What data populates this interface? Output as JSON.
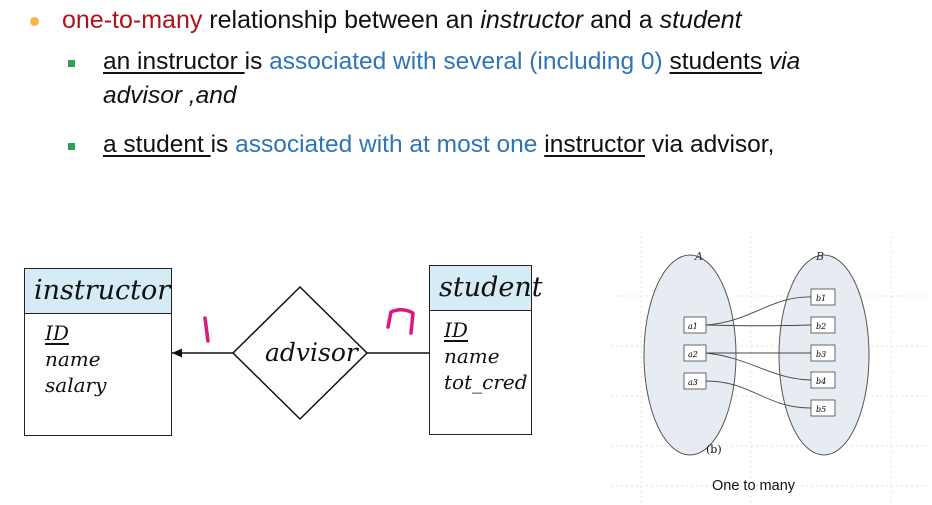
{
  "bullet": {
    "part1": "one-to-many",
    "part2": " relationship between an ",
    "part3": "instructor",
    "part4": " and a ",
    "part5": "student"
  },
  "sub1": {
    "a": "an instructor ",
    "b": "is ",
    "c": "associated with several (including 0)",
    "d": " ",
    "e": "students",
    "f": " via",
    "g": "advisor ,and"
  },
  "sub2": {
    "a": "a student ",
    "b": "is ",
    "c": "associated with at most one",
    "d": " ",
    "e": "instructor",
    "f": " via advisor,"
  },
  "er": {
    "instructor": {
      "name": "instructor",
      "attrs": [
        "ID",
        "name",
        "salary"
      ]
    },
    "student": {
      "name": "student",
      "attrs": [
        "ID",
        "name",
        "tot_cred"
      ]
    },
    "relationship": "advisor",
    "card_left": "1",
    "card_right": "n",
    "annotation_color": "#e0157e"
  },
  "setfig": {
    "set_a": "A",
    "set_b": "B",
    "a_items": [
      "a1",
      "a2",
      "a3"
    ],
    "b_items": [
      "b1",
      "b2",
      "b3",
      "b4",
      "b5"
    ],
    "sub_label": "(b)",
    "caption": "One to many"
  },
  "colors": {
    "accent_red": "#b0121b",
    "accent_blue": "#2e75b6",
    "entity_header": "#d5ecf6"
  }
}
